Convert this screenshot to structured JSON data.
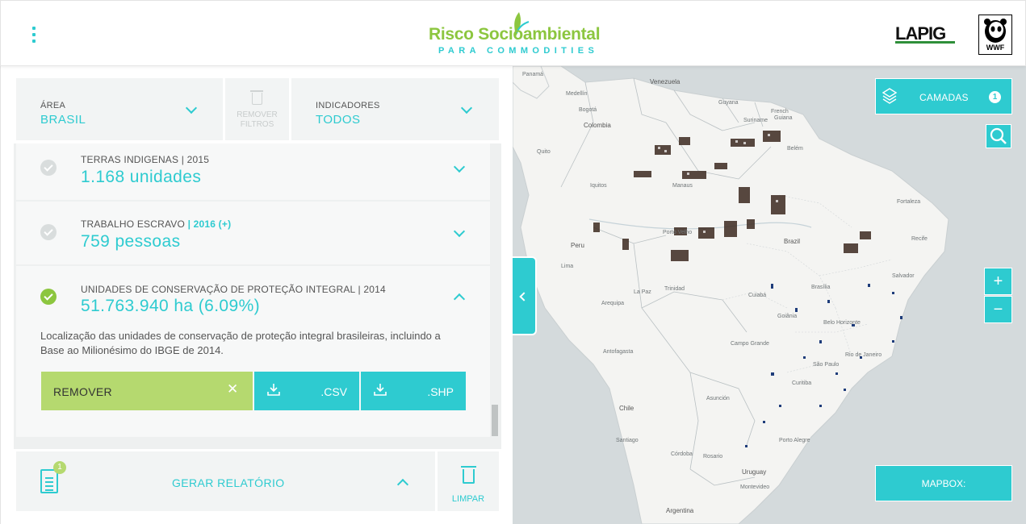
{
  "header": {
    "logo_main": "Risco Socioambiental",
    "logo_sub": "PARA COMMODITIES",
    "partner_logo_1": "LAPIG",
    "partner_logo_2": "WWF"
  },
  "filters": {
    "area_label": "ÁREA",
    "area_value": "BRASIL",
    "remove_label_1": "REMOVER",
    "remove_label_2": "FILTROS",
    "indicators_label": "INDICADORES",
    "indicators_value": "TODOS"
  },
  "indicators": [
    {
      "title": "TERRAS INDIGENAS | 2015",
      "value": "1.168 unidades",
      "active": false,
      "expanded": false
    },
    {
      "title": "TRABALHO ESCRAVO",
      "title_highlight": "| 2016 (+)",
      "value": "759 pessoas",
      "active": false,
      "expanded": false
    },
    {
      "title": "UNIDADES DE CONSERVAÇÃO DE PROTEÇÃO INTEGRAL | 2014",
      "value": "51.763.940 ha (6.09%)",
      "active": true,
      "expanded": true,
      "description": "Localização das unidades de conservação de proteção integral brasileiras, incluindo a Base ao Milionésimo do IBGE de 2014.",
      "remove_label": "REMOVER",
      "csv_label": ".CSV",
      "shp_label": ".SHP"
    }
  ],
  "report": {
    "label": "GERAR RELATÓRIO",
    "badge": "1"
  },
  "clear_label": "LIMPAR",
  "map": {
    "layers_label": "CAMADAS",
    "layers_badge": "1",
    "zoom_in": "+",
    "zoom_out": "−",
    "mapbox_label": "MAPBOX:",
    "place_labels": {
      "panama": "Panamá",
      "venezuela": "Venezuela",
      "guyana": "Guyana",
      "suriname": "Suriname",
      "french_guiana_1": "French",
      "french_guiana_2": "Guiana",
      "colombia": "Colombia",
      "peru": "Peru",
      "brazil": "Brazil",
      "chile": "Chile",
      "argentina": "Argentina",
      "uruguay": "Uruguay",
      "arequipa": "Arequipa",
      "goiania": "Goiânia",
      "belo_horizonte": "Belo Horizonte",
      "rio": "Rio de Janeiro",
      "sao_paulo": "São Paulo",
      "curitiba": "Curitiba",
      "porto_alegre": "Porto Alegre",
      "manaus": "Manaus",
      "santiago": "Santiago",
      "cordoba": "Córdoba",
      "rosario": "Rosario",
      "montevideo": "Montevideo",
      "salvador": "Salvador",
      "recife": "Recife",
      "fortaleza": "Fortaleza",
      "belem": "Belém",
      "brasilia": "Brasília",
      "cuiaba": "Cuiabá",
      "asuncion": "Asunción",
      "trinidad": "Trinidad",
      "iquitos": "Iquitos",
      "medellin": "Medellín",
      "bogota": "Bogotá",
      "quito": "Quito",
      "lima": "Lima",
      "la_paz": "La Paz",
      "antofagasta": "Antofagasta",
      "campo_grande": "Campo Grande",
      "porto_velho": "Porto Velho"
    }
  },
  "colors": {
    "accent": "#2ecbd0",
    "green": "#8cc63f",
    "remove_btn": "#b5d96f",
    "map_land": "#f4f4f2",
    "map_water": "#d4dadc"
  }
}
